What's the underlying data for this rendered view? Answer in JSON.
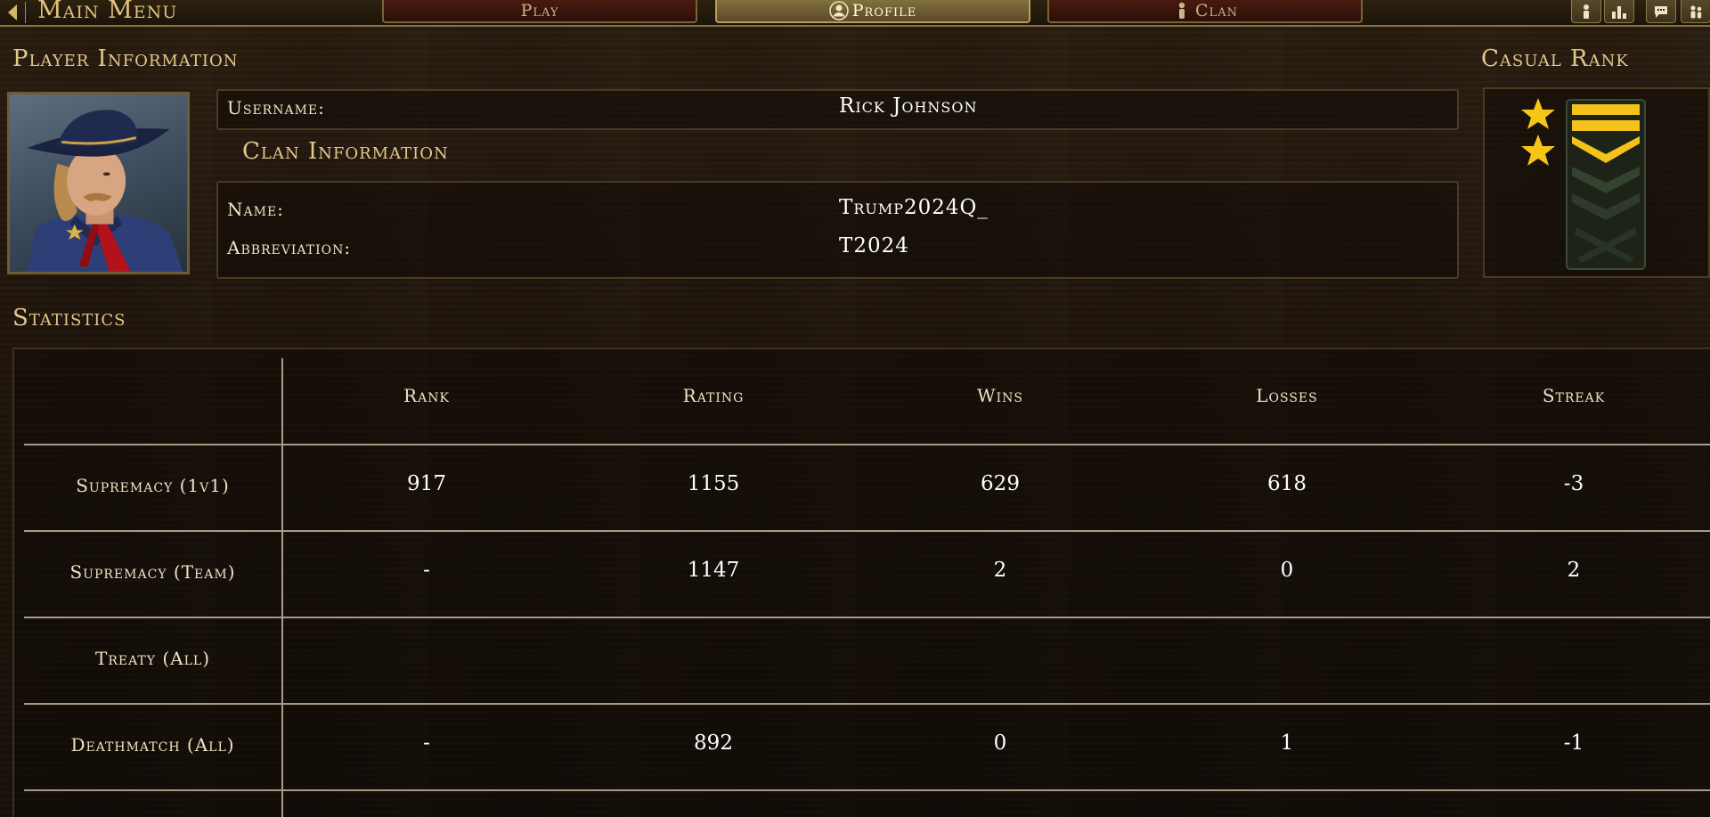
{
  "topbar": {
    "back_label": "Main Menu",
    "tabs": [
      {
        "label": "Play",
        "active": false
      },
      {
        "label": "Profile",
        "active": true
      },
      {
        "label": "Clan",
        "active": false
      }
    ],
    "icons": [
      "person-icon",
      "leaderboard-icon",
      "chat-icon",
      "friends-icon"
    ]
  },
  "player": {
    "heading": "Player Information",
    "username_label": "Username:",
    "username": "Rick Johnson"
  },
  "clan": {
    "heading": "Clan Information",
    "name_label": "Name:",
    "name": "Trump2024Q_",
    "abbrev_label": "Abbreviation:",
    "abbrev": "T2024"
  },
  "rank": {
    "heading": "Casual Rank",
    "stars": 2,
    "chevrons": 3
  },
  "statistics": {
    "heading": "Statistics",
    "columns": [
      "Rank",
      "Rating",
      "Wins",
      "Losses",
      "Streak"
    ],
    "rows": [
      {
        "mode": "Supremacy (1v1)",
        "values": [
          "917",
          "1155",
          "629",
          "618",
          "-3"
        ]
      },
      {
        "mode": "Supremacy (Team)",
        "values": [
          "-",
          "1147",
          "2",
          "0",
          "2"
        ]
      },
      {
        "mode": "Treaty (All)",
        "values": [
          "",
          "",
          "",
          "",
          ""
        ]
      },
      {
        "mode": "Deathmatch (All)",
        "values": [
          "-",
          "892",
          "0",
          "1",
          "-1"
        ]
      }
    ]
  },
  "colors": {
    "gold": "#e1c88c",
    "star": "#f5c518",
    "active_tab": "#82703f",
    "inactive_tab": "#4a1b0f"
  }
}
